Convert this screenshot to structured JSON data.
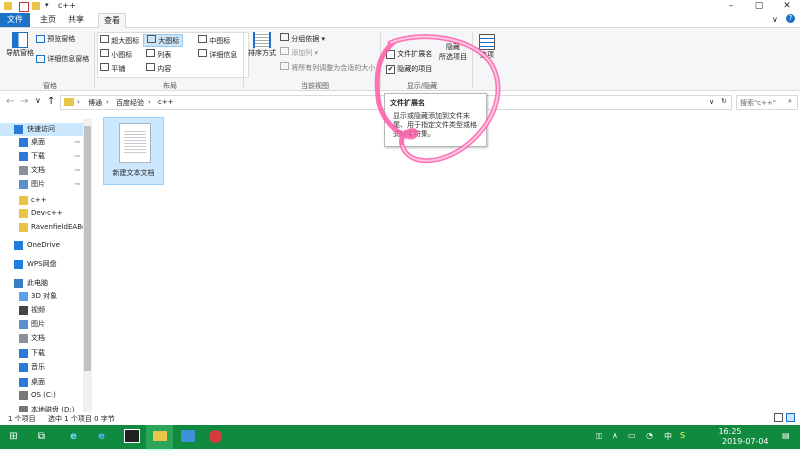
{
  "window": {
    "title": "c++"
  },
  "tabs": {
    "file": "文件",
    "home": "主页",
    "share": "共享",
    "view": "查看"
  },
  "ribbon": {
    "panes": {
      "nav_pane": "导航窗格",
      "preview_pane": "预览窗格",
      "details_pane": "详细信息窗格",
      "group": "窗格"
    },
    "layout": {
      "xl": "超大图标",
      "large": "大图标",
      "medium": "中图标",
      "small": "小图标",
      "list": "列表",
      "details": "详细信息",
      "tiles": "平铺",
      "content": "内容",
      "group": "布局"
    },
    "current_view": {
      "sort": "排序方式",
      "group_by": "分组依据",
      "add_col": "添加列",
      "fit_cols": "将所有列调整为合适的大小",
      "group": "当前视图"
    },
    "show_hide": {
      "ext": "文件扩展名",
      "hidden": "隐藏的项目",
      "hide": "隐藏",
      "hide2": "所选项目",
      "group": "显示/隐藏"
    },
    "options": "选项"
  },
  "tooltip": {
    "title": "文件扩展名",
    "body": "显示或隐藏添加到文件末尾、用于指定文件类型或格式的字符集。"
  },
  "address": {
    "crumbs": [
      "博通",
      "百度经验",
      "c++"
    ]
  },
  "search": {
    "placeholder": "搜索\"c++\""
  },
  "sidebar": {
    "items": [
      {
        "label": "快速访问",
        "icon": "star-icon",
        "indent": 0
      },
      {
        "label": "桌面",
        "icon": "desktop-icon",
        "indent": 1
      },
      {
        "label": "下载",
        "icon": "download-icon",
        "indent": 1
      },
      {
        "label": "文档",
        "icon": "document-icon",
        "indent": 1
      },
      {
        "label": "图片",
        "icon": "picture-icon",
        "indent": 1
      },
      {
        "label": "c++",
        "icon": "folder-icon",
        "indent": 1
      },
      {
        "label": "Dev-c++",
        "icon": "folder-icon",
        "indent": 1
      },
      {
        "label": "RavenfieldEABe",
        "icon": "folder-icon",
        "indent": 1
      },
      {
        "label": "OneDrive",
        "icon": "cloud-icon",
        "indent": 0
      },
      {
        "label": "WPS网盘",
        "icon": "cloud-icon",
        "indent": 0
      },
      {
        "label": "此电脑",
        "icon": "computer-icon",
        "indent": 0
      },
      {
        "label": "3D 对象",
        "icon": "cube-icon",
        "indent": 1
      },
      {
        "label": "视频",
        "icon": "video-icon",
        "indent": 1
      },
      {
        "label": "图片",
        "icon": "picture-icon",
        "indent": 1
      },
      {
        "label": "文档",
        "icon": "document-icon",
        "indent": 1
      },
      {
        "label": "下载",
        "icon": "download-icon",
        "indent": 1
      },
      {
        "label": "音乐",
        "icon": "music-icon",
        "indent": 1
      },
      {
        "label": "桌面",
        "icon": "desktop-icon",
        "indent": 1
      },
      {
        "label": "OS (C:)",
        "icon": "drive-icon",
        "indent": 1
      },
      {
        "label": "本地磁盘 (D:)",
        "icon": "drive-icon",
        "indent": 1
      }
    ]
  },
  "files": [
    {
      "name": "新建文本文档"
    }
  ],
  "status": {
    "count": "1 个项目",
    "selected": "选中 1 个项目  0 字节"
  },
  "taskbar": {
    "time": "16:25",
    "date": "2019-07-04",
    "ime": "中"
  },
  "colors": {
    "accent": "#1a73c9",
    "taskbar": "#0f8a3e",
    "selection": "#cce8ff",
    "highlight": "#ff5aa8"
  }
}
